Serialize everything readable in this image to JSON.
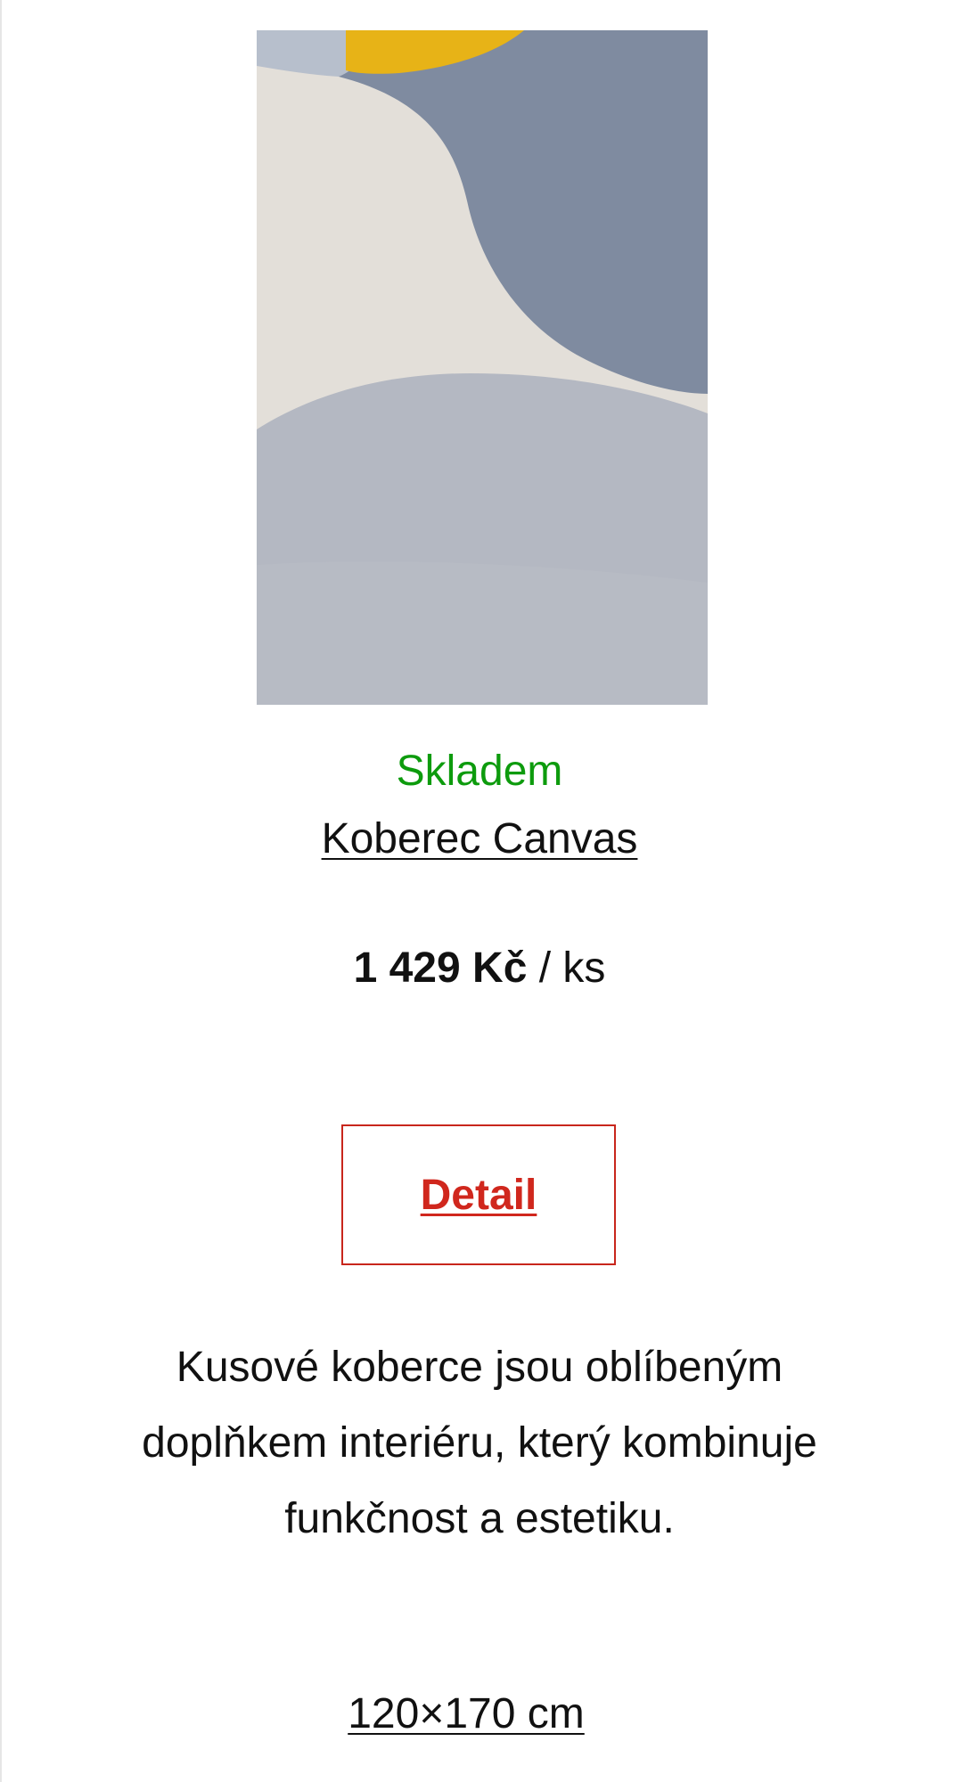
{
  "product": {
    "image_alt": "Koberec Canvas",
    "stock_status": "Skladem",
    "title": "Koberec Canvas",
    "price": "1 429 Kč",
    "price_unit": "/ ks",
    "detail_button_label": "Detail",
    "description": "Kusové koberce jsou oblíbeným doplňkem interiéru, který kombinuje funkčnost a estetiku.",
    "size": "120×170 cm"
  },
  "colors": {
    "stock_green": "#0d9b0d",
    "accent_red": "#d0271d",
    "text": "#111111"
  }
}
